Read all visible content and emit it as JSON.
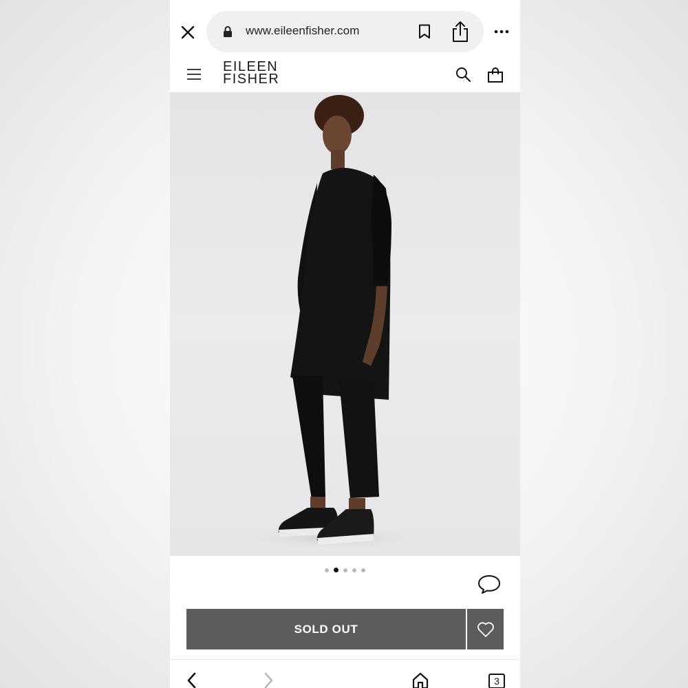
{
  "browser": {
    "url": "www.eileenfisher.com",
    "tab_count": "3"
  },
  "site": {
    "logo_line1": "EILEEN",
    "logo_line2": "FISHER"
  },
  "product": {
    "image_count": 5,
    "active_image_index": 1,
    "cta_label": "SOLD OUT"
  },
  "icons": {
    "close": "close-icon",
    "lock": "lock-icon",
    "bookmark": "bookmark-icon",
    "share": "share-icon",
    "more": "more-icon",
    "menu": "hamburger-icon",
    "search": "search-icon",
    "bag": "shopping-bag-icon",
    "chat": "chat-bubble-icon",
    "wishlist": "heart-icon",
    "back": "chevron-left-icon",
    "forward": "chevron-right-icon",
    "home": "home-icon"
  },
  "colors": {
    "cta_bg": "#5c5c5c",
    "url_pill_bg": "#f0f0f2",
    "hero_bg": "#e6e6e8"
  }
}
